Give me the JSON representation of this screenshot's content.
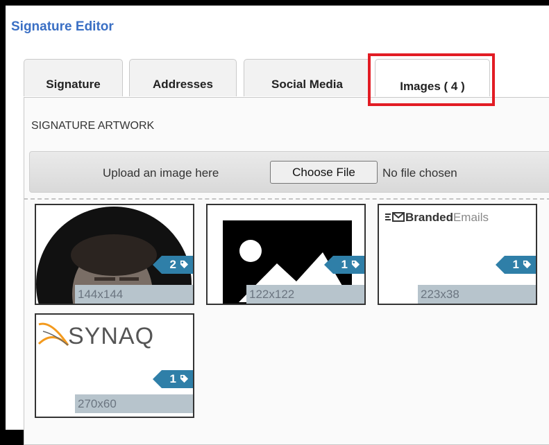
{
  "header": {
    "title": "Signature Editor"
  },
  "tabs": [
    {
      "label": "Signature"
    },
    {
      "label": "Addresses"
    },
    {
      "label": "Social Media"
    },
    {
      "label": "Images ( 4 )",
      "active": true
    }
  ],
  "section": {
    "label": "SIGNATURE ARTWORK"
  },
  "upload": {
    "label": "Upload an image here",
    "button_label": "Choose File",
    "status": "No file chosen"
  },
  "images": [
    {
      "name": "portrait-photo",
      "dimensions": "144x144",
      "tag_count": "2"
    },
    {
      "name": "placeholder-image",
      "dimensions": "122x122",
      "tag_count": "1"
    },
    {
      "name": "branded-emails-logo",
      "dimensions": "223x38",
      "tag_count": "1",
      "logo_text_bold": "Branded",
      "logo_text_light": "Emails"
    },
    {
      "name": "synaq-logo",
      "dimensions": "270x60",
      "tag_count": "1",
      "logo_text": "SYNAQ"
    }
  ],
  "colors": {
    "title": "#3a6fc4",
    "highlight": "#e21c24",
    "badge": "#2f7fa8",
    "dimension_bar": "#b7c4cc",
    "synaq_orange": "#f39a1e"
  }
}
